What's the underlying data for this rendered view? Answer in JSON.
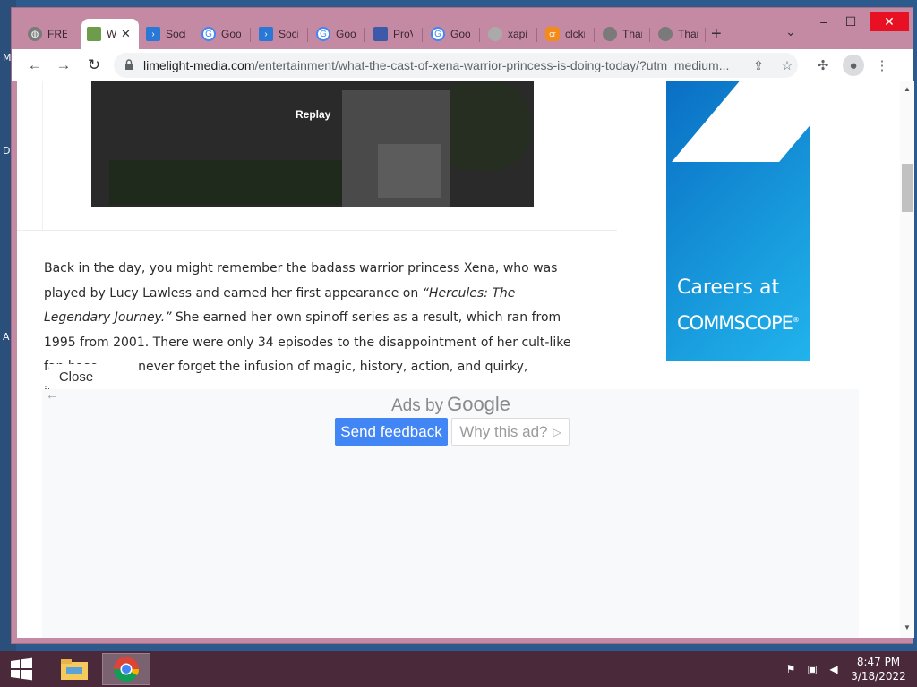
{
  "desktop": {
    "letters": [
      "M",
      "D",
      "A"
    ]
  },
  "window_controls": {
    "minimize": "–",
    "maximize": "☐",
    "close": "✕"
  },
  "tabs": [
    {
      "label": "FREE",
      "icon": "globe-icon",
      "color": "#7a7a7a"
    },
    {
      "label": "W",
      "icon": "map-icon",
      "color": "#6d9c4a",
      "active": true
    },
    {
      "label": "Soci",
      "icon": "arrow-icon",
      "color": "#2a78d6"
    },
    {
      "label": "Goo",
      "icon": "google-icon",
      "color": "#4285f4"
    },
    {
      "label": "Soci",
      "icon": "arrow-icon",
      "color": "#2a78d6"
    },
    {
      "label": "Goo",
      "icon": "google-icon",
      "color": "#4285f4"
    },
    {
      "label": "ProV",
      "icon": "window-icon",
      "color": "#3d5aa8"
    },
    {
      "label": "Goo",
      "icon": "google-icon",
      "color": "#4285f4"
    },
    {
      "label": "xapi",
      "icon": "globe-icon",
      "color": "#aaaaaa"
    },
    {
      "label": "clckr",
      "icon": "cr-icon",
      "color": "#f28b1a"
    },
    {
      "label": "Thar",
      "icon": "globe-icon",
      "color": "#7a7a7a"
    },
    {
      "label": "Thar",
      "icon": "globe-icon",
      "color": "#7a7a7a"
    }
  ],
  "new_tab": "+",
  "tab_search": "⌄",
  "toolbar": {
    "back": "←",
    "forward": "→",
    "reload": "↻"
  },
  "omnibox": {
    "host": "limelight-media.com",
    "path": "/entertainment/what-the-cast-of-xena-warrior-princess-is-doing-today/?utm_medium..."
  },
  "video": {
    "replay_label": "Replay"
  },
  "article": {
    "p1_a": "Back in the day, you might remember the badass warrior princess Xena, who was played by Lucy Lawless and earned her first appearance on ",
    "p1_em": "“Hercules: The Legendary Journey.”",
    "p1_b": " She earned her own spinoff series as a result, which ran from 1995 from 2001. There were only 34 episodes to the disappointment of her cult-like fan base, ",
    "p1_c": "never forget the infusion of magic, history, action, and quirky, innuendo-"
  },
  "ad_right": {
    "line1": "Careers at",
    "brand": "COMMSCOPE",
    "trademark": "®",
    "color": "#1aa0e0"
  },
  "ad_overlay": {
    "ads_by": "Ads by",
    "google": "Google",
    "send_feedback": "Send feedback",
    "why_this_ad": "Why this ad?",
    "why_icon": "▷",
    "back": "←",
    "close": "Close"
  },
  "taskbar": {
    "time": "8:47 PM",
    "date": "3/18/2022"
  }
}
